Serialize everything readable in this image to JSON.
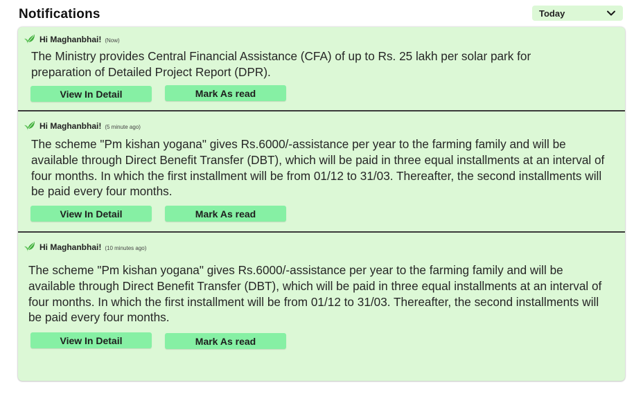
{
  "page": {
    "title": "Notifications",
    "filter": {
      "selected": "Today"
    }
  },
  "colors": {
    "panel_bg": "#dcf8d6",
    "button_bg": "#86f0a4",
    "divider": "#3a3a3a",
    "leaf_green": "#3fae3a"
  },
  "notifications": [
    {
      "greeting": "Hi Maghanbhai!",
      "time": "(Now)",
      "message": "The Ministry provides Central Financial Assistance (CFA) of up to Rs. 25 lakh per solar park for preparation of Detailed Project Report (DPR).",
      "view_label": "View In Detail",
      "mark_label": "Mark As read",
      "icon": "leaf-icon"
    },
    {
      "greeting": "Hi Maghanbhai!",
      "time": "(5 minute ago)",
      "message": "The scheme \"Pm kishan yogana\" gives Rs.6000/-assistance per year to the farming family and will be available through Direct Benefit Transfer (DBT), which will be paid in three equal installments at an interval of four months. In which the first installment will be from 01/12 to 31/03. Thereafter, the second installments will be paid every four months.",
      "view_label": "View In Detail",
      "mark_label": "Mark As read",
      "icon": "leaf-icon"
    },
    {
      "greeting": "Hi Maghanbhai!",
      "time": "(10 minutes ago)",
      "message": "The scheme \"Pm kishan yogana\" gives Rs.6000/-assistance per year to the farming family and will be available through Direct Benefit Transfer (DBT), which will be paid in three equal installments at an interval of four months. In which the first installment will be from 01/12 to 31/03. Thereafter, the second installments will be paid every four months.",
      "view_label": "View In Detail",
      "mark_label": "Mark As read",
      "icon": "leaf-icon"
    }
  ]
}
